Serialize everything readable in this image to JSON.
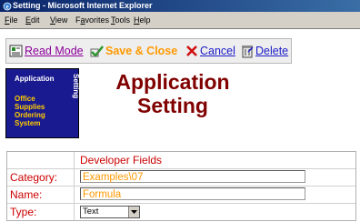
{
  "window": {
    "title": "Setting - Microsoft Internet Explorer"
  },
  "menu": [
    {
      "key": "F",
      "rest": "ile"
    },
    {
      "key": "E",
      "rest": "dit"
    },
    {
      "key": "V",
      "rest": "iew"
    },
    {
      "key": "",
      "prefix": "F",
      "key2": "a",
      "rest": "vorites"
    },
    {
      "key": "T",
      "rest": "ools"
    },
    {
      "key": "H",
      "rest": "elp"
    }
  ],
  "toolbar": {
    "read_mode": "Read Mode",
    "save_close": "Save & Close",
    "cancel": "Cancel",
    "delete": "Delete"
  },
  "logo": {
    "top": "Application",
    "side": "Setting",
    "lines": [
      "Office",
      "Supplies",
      "Ordering",
      "System"
    ]
  },
  "page": {
    "title_line1": "Application",
    "title_line2": "Setting"
  },
  "form": {
    "section_header": "Developer Fields",
    "category": {
      "label": "Category:",
      "value": "Examples\\07"
    },
    "name": {
      "label": "Name:",
      "value": "Formula"
    },
    "type": {
      "label": "Type:",
      "selected": "Text"
    }
  },
  "colors": {
    "title_red": "#800000",
    "label_red": "#cc0000",
    "input_orange": "#ff9900",
    "logo_blue": "#1a1a90"
  }
}
